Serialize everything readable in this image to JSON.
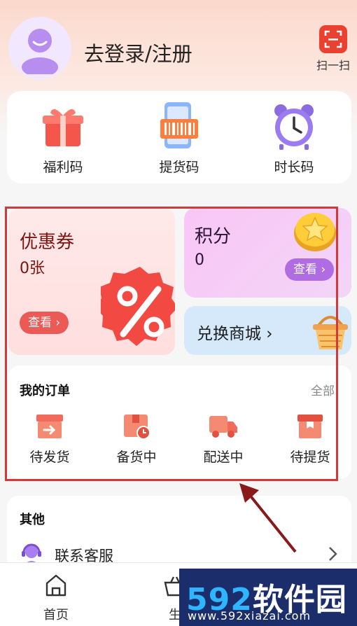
{
  "header": {
    "login_text": "去登录/注册",
    "scan_label": "扫一扫"
  },
  "quick_actions": [
    {
      "label": "福利码",
      "icon": "gift-icon"
    },
    {
      "label": "提货码",
      "icon": "barcode-phone-icon"
    },
    {
      "label": "时长码",
      "icon": "alarm-clock-icon"
    }
  ],
  "coupon": {
    "title": "优惠券",
    "count": "0张",
    "button": "查看 ›"
  },
  "points": {
    "title": "积分",
    "count": "0",
    "button": "查看 ›"
  },
  "mall": {
    "title": "兑换商城 ›"
  },
  "orders": {
    "title": "我的订单",
    "all": "全部",
    "items": [
      {
        "label": "待发货",
        "icon": "box-arrow-icon"
      },
      {
        "label": "备货中",
        "icon": "box-clock-icon"
      },
      {
        "label": "配送中",
        "icon": "truck-icon"
      },
      {
        "label": "待提货",
        "icon": "package-icon"
      }
    ]
  },
  "other": {
    "title": "其他",
    "service": "联系客服"
  },
  "tabbar": [
    {
      "label": "首页",
      "icon": "home-icon"
    },
    {
      "label": "生",
      "icon": "basket-icon"
    }
  ],
  "watermark": {
    "brand_num": "592",
    "brand_text": "软件园",
    "url": "www.592xiazai.com"
  },
  "colors": {
    "accent": "#ea4130",
    "highlight": "#d23a3a",
    "coupon_bg": "#ffdede",
    "points_bg": "#f9c6f6",
    "mall_bg": "#d6e9fb"
  }
}
